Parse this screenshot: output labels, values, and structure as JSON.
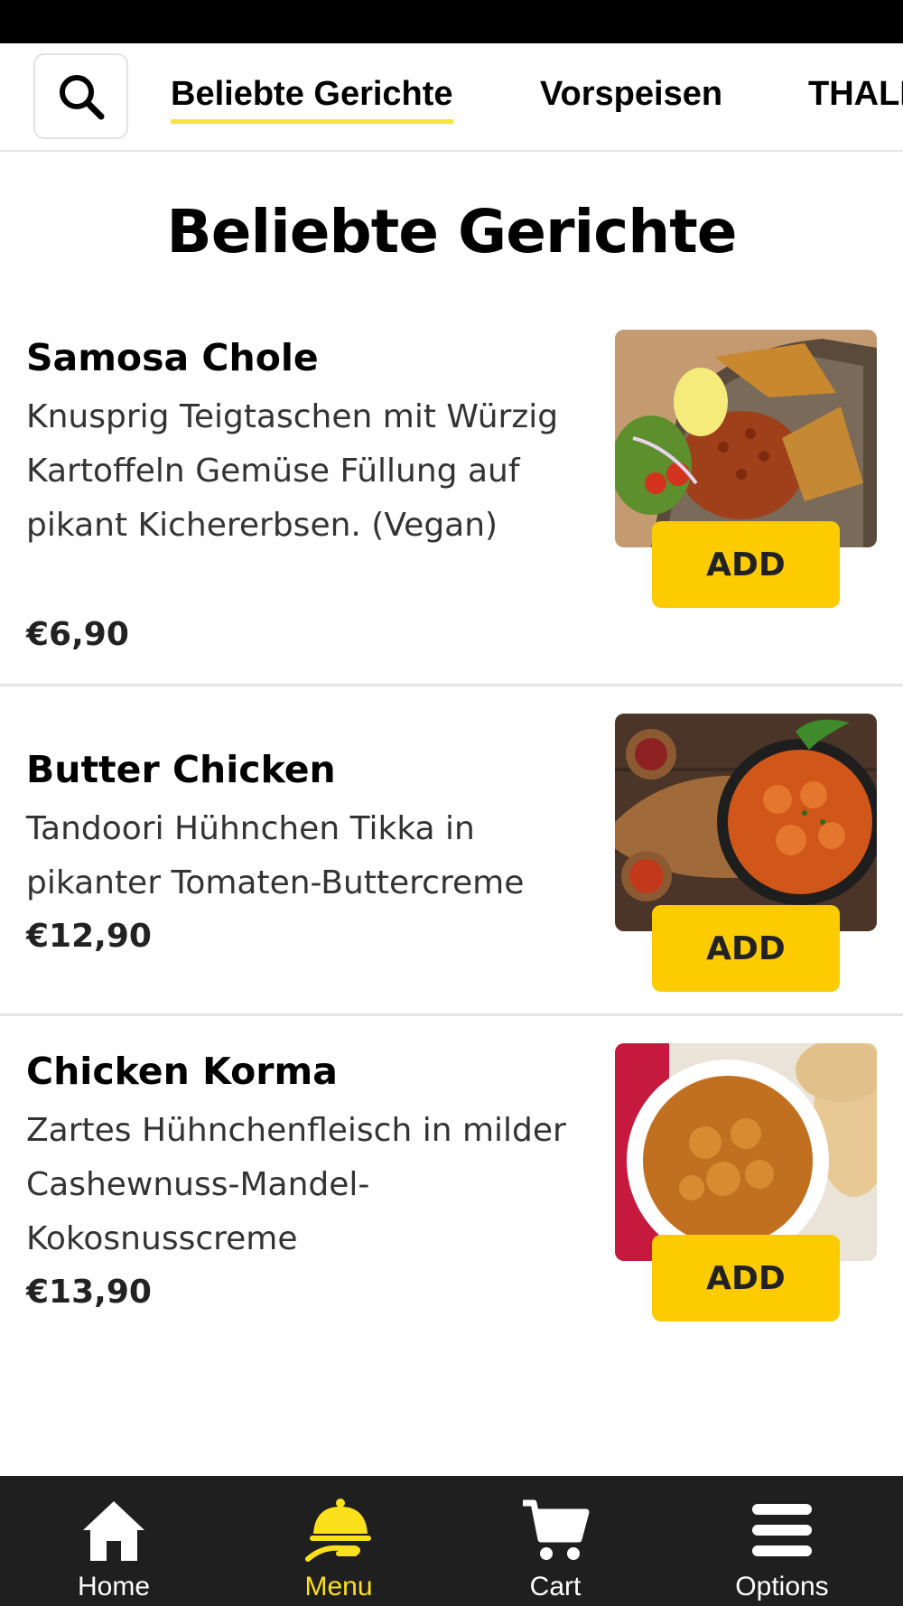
{
  "category_nav": {
    "search_icon": "search-icon",
    "tabs": [
      {
        "label": "Beliebte Gerichte",
        "active": true
      },
      {
        "label": "Vorspeisen",
        "active": false
      },
      {
        "label": "THALI",
        "active": false
      }
    ]
  },
  "section": {
    "title": "Beliebte Gerichte"
  },
  "items": [
    {
      "name": "Samosa Chole",
      "description": "Knusprig Teigtaschen mit Würzig Kartoffeln Gemüse Füllung auf pikant Kichererbsen. (Vegan)",
      "price": "€6,90",
      "add_label": "ADD"
    },
    {
      "name": "Butter Chicken",
      "description": "Tandoori Hühnchen Tikka in pikanter Tomaten-Buttercreme",
      "price": "€12,90",
      "add_label": "ADD"
    },
    {
      "name": "Chicken Korma",
      "description": "Zartes Hühnchenfleisch in milder Cashewnuss-Mandel-Kokosnusscreme",
      "price": "€13,90",
      "add_label": "ADD"
    }
  ],
  "bottom_nav": [
    {
      "label": "Home",
      "icon": "home-icon",
      "active": false
    },
    {
      "label": "Menu",
      "icon": "cloche-icon",
      "active": true
    },
    {
      "label": "Cart",
      "icon": "cart-icon",
      "active": false
    },
    {
      "label": "Options",
      "icon": "menu-icon",
      "active": false
    }
  ],
  "colors": {
    "accent_yellow": "#fccb00",
    "active_nav": "#fbe01b",
    "nav_bg": "#1f1f1f"
  }
}
